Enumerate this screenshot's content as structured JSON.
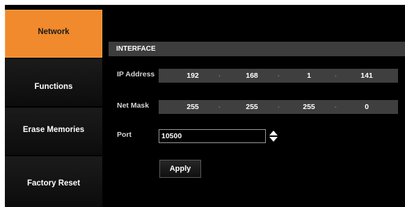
{
  "sidebar": {
    "items": [
      {
        "label": "Network",
        "active": true
      },
      {
        "label": "Functions",
        "active": false
      },
      {
        "label": "Erase Memories",
        "active": false
      },
      {
        "label": "Factory Reset",
        "active": false
      }
    ]
  },
  "interface": {
    "header": "INTERFACE",
    "ip_address": {
      "label": "IP Address",
      "octets": [
        "192",
        "168",
        "1",
        "141"
      ],
      "separator": "."
    },
    "net_mask": {
      "label": "Net Mask",
      "octets": [
        "255",
        "255",
        "255",
        "0"
      ],
      "separator": "."
    },
    "port": {
      "label": "Port",
      "value": "10500"
    },
    "apply_label": "Apply"
  },
  "icons": {
    "stepper": "up-down-stepper-icon"
  },
  "colors": {
    "accent": "#f08a2c",
    "background": "#000000",
    "field": "#3f3f3f"
  }
}
